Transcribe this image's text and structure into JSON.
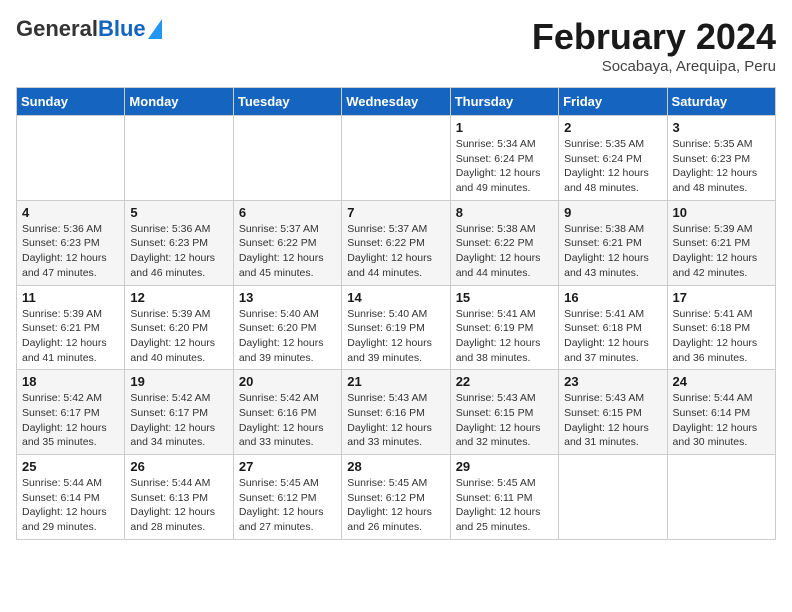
{
  "logo": {
    "general": "General",
    "blue": "Blue"
  },
  "title": "February 2024",
  "location": "Socabaya, Arequipa, Peru",
  "days_of_week": [
    "Sunday",
    "Monday",
    "Tuesday",
    "Wednesday",
    "Thursday",
    "Friday",
    "Saturday"
  ],
  "weeks": [
    [
      {
        "day": "",
        "info": ""
      },
      {
        "day": "",
        "info": ""
      },
      {
        "day": "",
        "info": ""
      },
      {
        "day": "",
        "info": ""
      },
      {
        "day": "1",
        "info": "Sunrise: 5:34 AM\nSunset: 6:24 PM\nDaylight: 12 hours\nand 49 minutes."
      },
      {
        "day": "2",
        "info": "Sunrise: 5:35 AM\nSunset: 6:24 PM\nDaylight: 12 hours\nand 48 minutes."
      },
      {
        "day": "3",
        "info": "Sunrise: 5:35 AM\nSunset: 6:23 PM\nDaylight: 12 hours\nand 48 minutes."
      }
    ],
    [
      {
        "day": "4",
        "info": "Sunrise: 5:36 AM\nSunset: 6:23 PM\nDaylight: 12 hours\nand 47 minutes."
      },
      {
        "day": "5",
        "info": "Sunrise: 5:36 AM\nSunset: 6:23 PM\nDaylight: 12 hours\nand 46 minutes."
      },
      {
        "day": "6",
        "info": "Sunrise: 5:37 AM\nSunset: 6:22 PM\nDaylight: 12 hours\nand 45 minutes."
      },
      {
        "day": "7",
        "info": "Sunrise: 5:37 AM\nSunset: 6:22 PM\nDaylight: 12 hours\nand 44 minutes."
      },
      {
        "day": "8",
        "info": "Sunrise: 5:38 AM\nSunset: 6:22 PM\nDaylight: 12 hours\nand 44 minutes."
      },
      {
        "day": "9",
        "info": "Sunrise: 5:38 AM\nSunset: 6:21 PM\nDaylight: 12 hours\nand 43 minutes."
      },
      {
        "day": "10",
        "info": "Sunrise: 5:39 AM\nSunset: 6:21 PM\nDaylight: 12 hours\nand 42 minutes."
      }
    ],
    [
      {
        "day": "11",
        "info": "Sunrise: 5:39 AM\nSunset: 6:21 PM\nDaylight: 12 hours\nand 41 minutes."
      },
      {
        "day": "12",
        "info": "Sunrise: 5:39 AM\nSunset: 6:20 PM\nDaylight: 12 hours\nand 40 minutes."
      },
      {
        "day": "13",
        "info": "Sunrise: 5:40 AM\nSunset: 6:20 PM\nDaylight: 12 hours\nand 39 minutes."
      },
      {
        "day": "14",
        "info": "Sunrise: 5:40 AM\nSunset: 6:19 PM\nDaylight: 12 hours\nand 39 minutes."
      },
      {
        "day": "15",
        "info": "Sunrise: 5:41 AM\nSunset: 6:19 PM\nDaylight: 12 hours\nand 38 minutes."
      },
      {
        "day": "16",
        "info": "Sunrise: 5:41 AM\nSunset: 6:18 PM\nDaylight: 12 hours\nand 37 minutes."
      },
      {
        "day": "17",
        "info": "Sunrise: 5:41 AM\nSunset: 6:18 PM\nDaylight: 12 hours\nand 36 minutes."
      }
    ],
    [
      {
        "day": "18",
        "info": "Sunrise: 5:42 AM\nSunset: 6:17 PM\nDaylight: 12 hours\nand 35 minutes."
      },
      {
        "day": "19",
        "info": "Sunrise: 5:42 AM\nSunset: 6:17 PM\nDaylight: 12 hours\nand 34 minutes."
      },
      {
        "day": "20",
        "info": "Sunrise: 5:42 AM\nSunset: 6:16 PM\nDaylight: 12 hours\nand 33 minutes."
      },
      {
        "day": "21",
        "info": "Sunrise: 5:43 AM\nSunset: 6:16 PM\nDaylight: 12 hours\nand 33 minutes."
      },
      {
        "day": "22",
        "info": "Sunrise: 5:43 AM\nSunset: 6:15 PM\nDaylight: 12 hours\nand 32 minutes."
      },
      {
        "day": "23",
        "info": "Sunrise: 5:43 AM\nSunset: 6:15 PM\nDaylight: 12 hours\nand 31 minutes."
      },
      {
        "day": "24",
        "info": "Sunrise: 5:44 AM\nSunset: 6:14 PM\nDaylight: 12 hours\nand 30 minutes."
      }
    ],
    [
      {
        "day": "25",
        "info": "Sunrise: 5:44 AM\nSunset: 6:14 PM\nDaylight: 12 hours\nand 29 minutes."
      },
      {
        "day": "26",
        "info": "Sunrise: 5:44 AM\nSunset: 6:13 PM\nDaylight: 12 hours\nand 28 minutes."
      },
      {
        "day": "27",
        "info": "Sunrise: 5:45 AM\nSunset: 6:12 PM\nDaylight: 12 hours\nand 27 minutes."
      },
      {
        "day": "28",
        "info": "Sunrise: 5:45 AM\nSunset: 6:12 PM\nDaylight: 12 hours\nand 26 minutes."
      },
      {
        "day": "29",
        "info": "Sunrise: 5:45 AM\nSunset: 6:11 PM\nDaylight: 12 hours\nand 25 minutes."
      },
      {
        "day": "",
        "info": ""
      },
      {
        "day": "",
        "info": ""
      }
    ]
  ]
}
